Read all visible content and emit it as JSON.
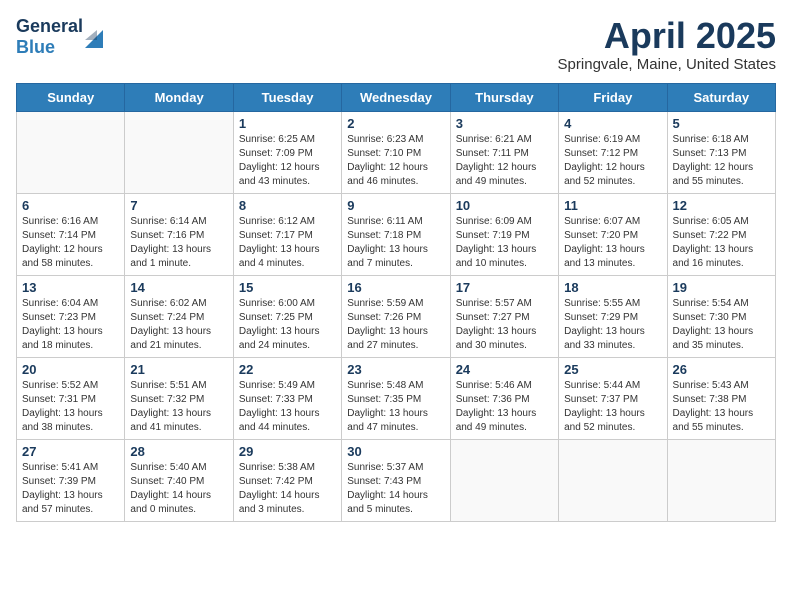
{
  "header": {
    "logo_general": "General",
    "logo_blue": "Blue",
    "month": "April 2025",
    "location": "Springvale, Maine, United States"
  },
  "days_of_week": [
    "Sunday",
    "Monday",
    "Tuesday",
    "Wednesday",
    "Thursday",
    "Friday",
    "Saturday"
  ],
  "weeks": [
    [
      {
        "day": "",
        "info": ""
      },
      {
        "day": "",
        "info": ""
      },
      {
        "day": "1",
        "info": "Sunrise: 6:25 AM\nSunset: 7:09 PM\nDaylight: 12 hours and 43 minutes."
      },
      {
        "day": "2",
        "info": "Sunrise: 6:23 AM\nSunset: 7:10 PM\nDaylight: 12 hours and 46 minutes."
      },
      {
        "day": "3",
        "info": "Sunrise: 6:21 AM\nSunset: 7:11 PM\nDaylight: 12 hours and 49 minutes."
      },
      {
        "day": "4",
        "info": "Sunrise: 6:19 AM\nSunset: 7:12 PM\nDaylight: 12 hours and 52 minutes."
      },
      {
        "day": "5",
        "info": "Sunrise: 6:18 AM\nSunset: 7:13 PM\nDaylight: 12 hours and 55 minutes."
      }
    ],
    [
      {
        "day": "6",
        "info": "Sunrise: 6:16 AM\nSunset: 7:14 PM\nDaylight: 12 hours and 58 minutes."
      },
      {
        "day": "7",
        "info": "Sunrise: 6:14 AM\nSunset: 7:16 PM\nDaylight: 13 hours and 1 minute."
      },
      {
        "day": "8",
        "info": "Sunrise: 6:12 AM\nSunset: 7:17 PM\nDaylight: 13 hours and 4 minutes."
      },
      {
        "day": "9",
        "info": "Sunrise: 6:11 AM\nSunset: 7:18 PM\nDaylight: 13 hours and 7 minutes."
      },
      {
        "day": "10",
        "info": "Sunrise: 6:09 AM\nSunset: 7:19 PM\nDaylight: 13 hours and 10 minutes."
      },
      {
        "day": "11",
        "info": "Sunrise: 6:07 AM\nSunset: 7:20 PM\nDaylight: 13 hours and 13 minutes."
      },
      {
        "day": "12",
        "info": "Sunrise: 6:05 AM\nSunset: 7:22 PM\nDaylight: 13 hours and 16 minutes."
      }
    ],
    [
      {
        "day": "13",
        "info": "Sunrise: 6:04 AM\nSunset: 7:23 PM\nDaylight: 13 hours and 18 minutes."
      },
      {
        "day": "14",
        "info": "Sunrise: 6:02 AM\nSunset: 7:24 PM\nDaylight: 13 hours and 21 minutes."
      },
      {
        "day": "15",
        "info": "Sunrise: 6:00 AM\nSunset: 7:25 PM\nDaylight: 13 hours and 24 minutes."
      },
      {
        "day": "16",
        "info": "Sunrise: 5:59 AM\nSunset: 7:26 PM\nDaylight: 13 hours and 27 minutes."
      },
      {
        "day": "17",
        "info": "Sunrise: 5:57 AM\nSunset: 7:27 PM\nDaylight: 13 hours and 30 minutes."
      },
      {
        "day": "18",
        "info": "Sunrise: 5:55 AM\nSunset: 7:29 PM\nDaylight: 13 hours and 33 minutes."
      },
      {
        "day": "19",
        "info": "Sunrise: 5:54 AM\nSunset: 7:30 PM\nDaylight: 13 hours and 35 minutes."
      }
    ],
    [
      {
        "day": "20",
        "info": "Sunrise: 5:52 AM\nSunset: 7:31 PM\nDaylight: 13 hours and 38 minutes."
      },
      {
        "day": "21",
        "info": "Sunrise: 5:51 AM\nSunset: 7:32 PM\nDaylight: 13 hours and 41 minutes."
      },
      {
        "day": "22",
        "info": "Sunrise: 5:49 AM\nSunset: 7:33 PM\nDaylight: 13 hours and 44 minutes."
      },
      {
        "day": "23",
        "info": "Sunrise: 5:48 AM\nSunset: 7:35 PM\nDaylight: 13 hours and 47 minutes."
      },
      {
        "day": "24",
        "info": "Sunrise: 5:46 AM\nSunset: 7:36 PM\nDaylight: 13 hours and 49 minutes."
      },
      {
        "day": "25",
        "info": "Sunrise: 5:44 AM\nSunset: 7:37 PM\nDaylight: 13 hours and 52 minutes."
      },
      {
        "day": "26",
        "info": "Sunrise: 5:43 AM\nSunset: 7:38 PM\nDaylight: 13 hours and 55 minutes."
      }
    ],
    [
      {
        "day": "27",
        "info": "Sunrise: 5:41 AM\nSunset: 7:39 PM\nDaylight: 13 hours and 57 minutes."
      },
      {
        "day": "28",
        "info": "Sunrise: 5:40 AM\nSunset: 7:40 PM\nDaylight: 14 hours and 0 minutes."
      },
      {
        "day": "29",
        "info": "Sunrise: 5:38 AM\nSunset: 7:42 PM\nDaylight: 14 hours and 3 minutes."
      },
      {
        "day": "30",
        "info": "Sunrise: 5:37 AM\nSunset: 7:43 PM\nDaylight: 14 hours and 5 minutes."
      },
      {
        "day": "",
        "info": ""
      },
      {
        "day": "",
        "info": ""
      },
      {
        "day": "",
        "info": ""
      }
    ]
  ]
}
